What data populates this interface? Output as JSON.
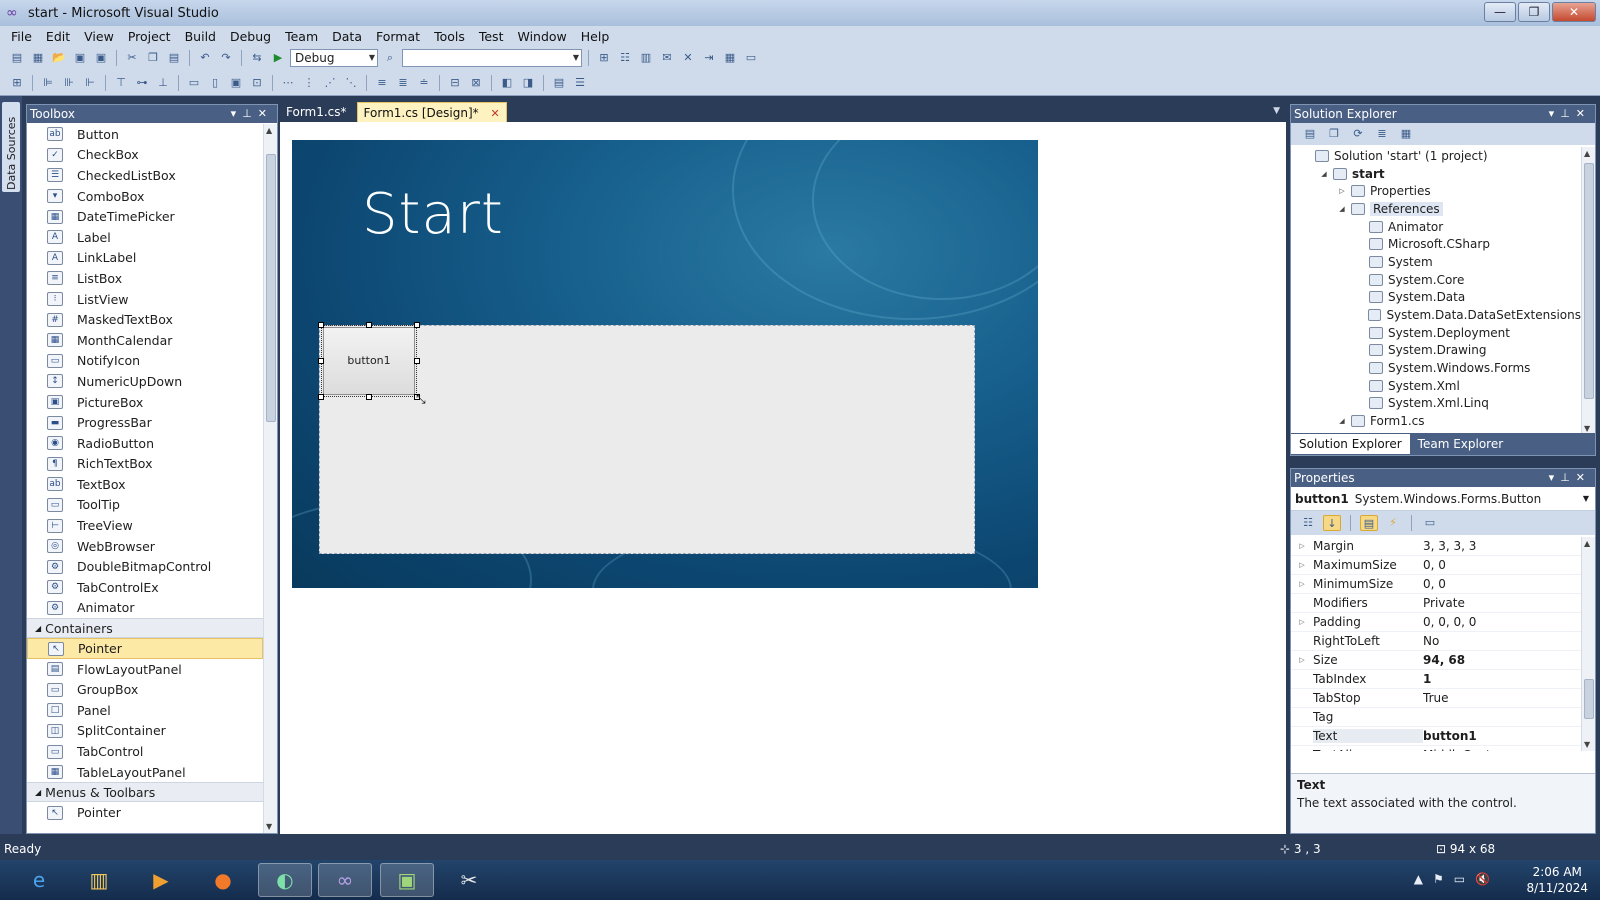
{
  "window": {
    "title": "start - Microsoft Visual Studio",
    "minimize": "—",
    "maximize": "❐",
    "close": "✕"
  },
  "menu": [
    "File",
    "Edit",
    "View",
    "Project",
    "Build",
    "Debug",
    "Team",
    "Data",
    "Format",
    "Tools",
    "Test",
    "Window",
    "Help"
  ],
  "toolbar": {
    "config": "Debug",
    "platform": ""
  },
  "datasources_tab": "Data Sources",
  "toolbox": {
    "title": "Toolbox",
    "items": [
      "Button",
      "CheckBox",
      "CheckedListBox",
      "ComboBox",
      "DateTimePicker",
      "Label",
      "LinkLabel",
      "ListBox",
      "ListView",
      "MaskedTextBox",
      "MonthCalendar",
      "NotifyIcon",
      "NumericUpDown",
      "PictureBox",
      "ProgressBar",
      "RadioButton",
      "RichTextBox",
      "TextBox",
      "ToolTip",
      "TreeView",
      "WebBrowser",
      "DoubleBitmapControl",
      "TabControlEx",
      "Animator"
    ],
    "containers_header": "Containers",
    "containers": [
      "Pointer",
      "FlowLayoutPanel",
      "GroupBox",
      "Panel",
      "SplitContainer",
      "TabControl",
      "TableLayoutPanel"
    ],
    "menus_header": "Menus & Toolbars",
    "menus": [
      "Pointer"
    ]
  },
  "doc_tabs": [
    {
      "label": "Form1.cs*"
    },
    {
      "label": "Form1.cs [Design]*"
    }
  ],
  "designer": {
    "form_title": "Start",
    "button_text": "button1"
  },
  "solution_explorer": {
    "title": "Solution Explorer",
    "nodes": [
      {
        "label": "Solution 'start' (1 project)",
        "level": 0,
        "exp": ""
      },
      {
        "label": "start",
        "level": 1,
        "exp": "◢",
        "bold": true
      },
      {
        "label": "Properties",
        "level": 2,
        "exp": "▷"
      },
      {
        "label": "References",
        "level": 2,
        "exp": "◢",
        "hl": true
      },
      {
        "label": "Animator",
        "level": 3,
        "exp": ""
      },
      {
        "label": "Microsoft.CSharp",
        "level": 3,
        "exp": ""
      },
      {
        "label": "System",
        "level": 3,
        "exp": ""
      },
      {
        "label": "System.Core",
        "level": 3,
        "exp": ""
      },
      {
        "label": "System.Data",
        "level": 3,
        "exp": ""
      },
      {
        "label": "System.Data.DataSetExtensions",
        "level": 3,
        "exp": ""
      },
      {
        "label": "System.Deployment",
        "level": 3,
        "exp": ""
      },
      {
        "label": "System.Drawing",
        "level": 3,
        "exp": ""
      },
      {
        "label": "System.Windows.Forms",
        "level": 3,
        "exp": ""
      },
      {
        "label": "System.Xml",
        "level": 3,
        "exp": ""
      },
      {
        "label": "System.Xml.Linq",
        "level": 3,
        "exp": ""
      },
      {
        "label": "Form1.cs",
        "level": 2,
        "exp": "◢"
      }
    ],
    "tabs": [
      "Solution Explorer",
      "Team Explorer"
    ]
  },
  "properties": {
    "title": "Properties",
    "object_name": "button1",
    "object_type": "System.Windows.Forms.Button",
    "rows": [
      {
        "name": "Margin",
        "value": "3, 3, 3, 3",
        "exp": "▷"
      },
      {
        "name": "MaximumSize",
        "value": "0, 0",
        "exp": "▷"
      },
      {
        "name": "MinimumSize",
        "value": "0, 0",
        "exp": "▷"
      },
      {
        "name": "Modifiers",
        "value": "Private",
        "exp": ""
      },
      {
        "name": "Padding",
        "value": "0, 0, 0, 0",
        "exp": "▷"
      },
      {
        "name": "RightToLeft",
        "value": "No",
        "exp": ""
      },
      {
        "name": "Size",
        "value": "94, 68",
        "exp": "▷",
        "bold": true
      },
      {
        "name": "TabIndex",
        "value": "1",
        "exp": "",
        "bold": true
      },
      {
        "name": "TabStop",
        "value": "True",
        "exp": ""
      },
      {
        "name": "Tag",
        "value": "",
        "exp": ""
      },
      {
        "name": "Text",
        "value": "button1",
        "exp": "",
        "bold": true,
        "selected": true
      },
      {
        "name": "TextAlign",
        "value": "MiddleCenter",
        "exp": ""
      }
    ],
    "desc_title": "Text",
    "desc_text": "The text associated with the control."
  },
  "status": {
    "text": "Ready",
    "position": "3 , 3",
    "size": "94 x 68"
  },
  "taskbar": {
    "time": "2:06 AM",
    "date": "8/11/2024"
  },
  "colors": {
    "chrome": "#2b3c59",
    "header": "#4a5f84",
    "selected": "#fde9a6"
  }
}
